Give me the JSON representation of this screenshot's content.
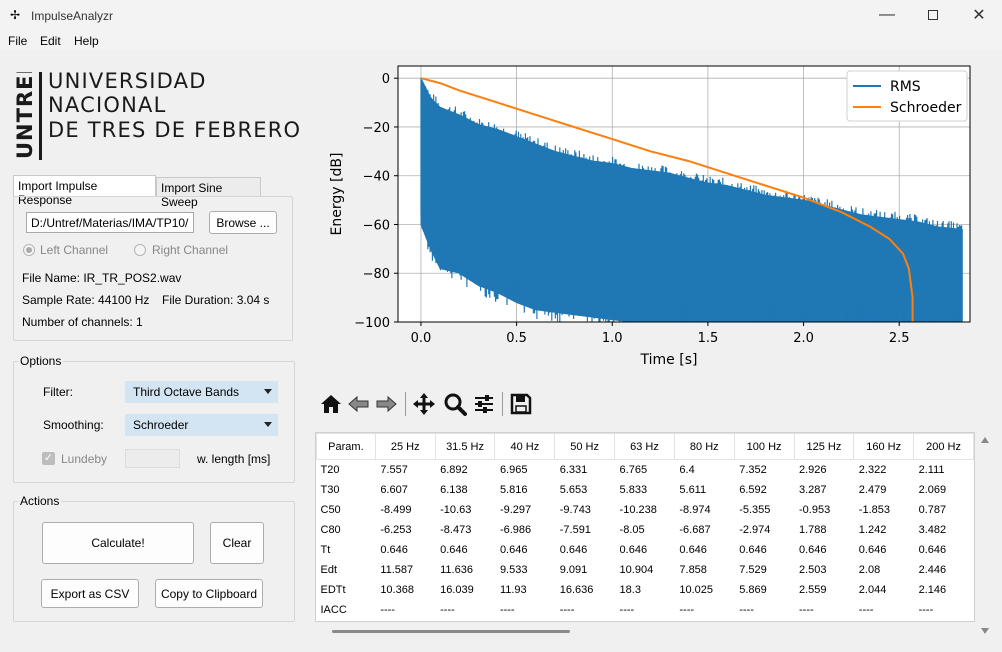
{
  "window": {
    "title": "ImpulseAnalyzr",
    "icon": "app-icon",
    "controls": [
      "minimize-icon",
      "maximize-icon",
      "close-icon"
    ]
  },
  "menu": {
    "items": [
      "File",
      "Edit",
      "Help"
    ]
  },
  "logo": {
    "vertical_text": "UNTREF",
    "lines": [
      "UNIVERSIDAD",
      "NACIONAL",
      "DE TRES DE FEBRERO"
    ]
  },
  "tabs": [
    {
      "label": "Import Impulse Response",
      "active": true
    },
    {
      "label": "Import Sine Sweep",
      "active": false
    }
  ],
  "import": {
    "path": "D:/Untref/Materias/IMA/TP10/",
    "browse_label": "Browse ...",
    "left_channel": "Left Channel",
    "right_channel": "Right Channel",
    "file_name": "File Name: IR_TR_POS2.wav",
    "sample_rate": "Sample Rate: 44100 Hz",
    "file_duration": "File Duration: 3.04 s",
    "channels": "Number of channels: 1"
  },
  "options": {
    "title": "Options",
    "filter_label": "Filter:",
    "filter_value": "Third Octave Bands",
    "smoothing_label": "Smoothing:",
    "smoothing_value": "Schroeder",
    "lundeby_label": "Lundeby",
    "lundeby_checked": true,
    "wlength_label": "w. length [ms]",
    "wlength_value": ""
  },
  "actions": {
    "title": "Actions",
    "calculate": "Calculate!",
    "clear": "Clear",
    "export_csv": "Export as CSV",
    "copy_clipboard": "Copy to Clipboard"
  },
  "toolbar": {
    "icons": [
      "home-icon",
      "back-icon",
      "forward-icon",
      "pan-icon",
      "zoom-icon",
      "configure-icon",
      "save-icon"
    ]
  },
  "colors": {
    "rms": "#1f77b4",
    "schroeder": "#ff7f0e",
    "combo_bg": "#d3e4f3"
  },
  "chart_data": {
    "type": "line",
    "title": "",
    "xlabel": "Time [s]",
    "ylabel": "Energy [dB]",
    "xlim": [
      -0.12,
      2.87
    ],
    "ylim": [
      -100,
      5
    ],
    "xticks": [
      "0.0",
      "0.5",
      "1.0",
      "1.5",
      "2.0",
      "2.5"
    ],
    "yticks": [
      "0",
      "−20",
      "−40",
      "−60",
      "−80",
      "−100"
    ],
    "legend": "top-right",
    "grid": true,
    "series": [
      {
        "name": "RMS",
        "x": [
          0.0,
          0.05,
          0.1,
          0.2,
          0.3,
          0.4,
          0.5,
          0.6,
          0.7,
          0.8,
          0.9,
          1.0,
          1.1,
          1.2,
          1.3,
          1.4,
          1.5,
          1.6,
          1.7,
          1.8,
          1.9,
          2.0,
          2.1,
          2.2,
          2.3,
          2.4,
          2.5,
          2.6,
          2.7,
          2.83
        ],
        "upper": [
          0,
          -8,
          -12,
          -15,
          -19,
          -21,
          -24,
          -27,
          -30,
          -32,
          -34,
          -35,
          -37,
          -38,
          -39,
          -41,
          -43,
          -44,
          -46,
          -48,
          -49,
          -50,
          -52,
          -54,
          -56,
          -57,
          -58,
          -59,
          -61,
          -62
        ],
        "lower": [
          -60,
          -70,
          -78,
          -80,
          -85,
          -88,
          -92,
          -95,
          -96,
          -97,
          -98,
          -99,
          -100,
          -100,
          -100,
          -100,
          -100,
          -100,
          -100,
          -100,
          -100,
          -100,
          -100,
          -100,
          -100,
          -100,
          -100,
          -100,
          -100,
          -100
        ]
      },
      {
        "name": "Schroeder",
        "x": [
          0.0,
          0.1,
          0.2,
          0.4,
          0.6,
          0.8,
          1.0,
          1.2,
          1.4,
          1.6,
          1.8,
          2.0,
          2.2,
          2.35,
          2.45,
          2.52,
          2.55,
          2.57,
          2.57
        ],
        "y": [
          0,
          -2,
          -5,
          -10,
          -15,
          -20,
          -25,
          -30,
          -34,
          -39,
          -44,
          -49,
          -55,
          -61,
          -66,
          -72,
          -78,
          -90,
          -100
        ]
      }
    ]
  },
  "results_table": {
    "columns": [
      "Param.",
      "25 Hz",
      "31.5 Hz",
      "40 Hz",
      "50 Hz",
      "63 Hz",
      "80 Hz",
      "100 Hz",
      "125 Hz",
      "160 Hz",
      "200 Hz"
    ],
    "rows": [
      [
        "T20",
        "7.557",
        "6.892",
        "6.965",
        "6.331",
        "6.765",
        "6.4",
        "7.352",
        "2.926",
        "2.322",
        "2.111"
      ],
      [
        "T30",
        "6.607",
        "6.138",
        "5.816",
        "5.653",
        "5.833",
        "5.611",
        "6.592",
        "3.287",
        "2.479",
        "2.069"
      ],
      [
        "C50",
        "-8.499",
        "-10.63",
        "-9.297",
        "-9.743",
        "-10.238",
        "-8.974",
        "-5.355",
        "-0.953",
        "-1.853",
        "0.787"
      ],
      [
        "C80",
        "-6.253",
        "-8.473",
        "-6.986",
        "-7.591",
        "-8.05",
        "-6.687",
        "-2.974",
        "1.788",
        "1.242",
        "3.482"
      ],
      [
        "Tt",
        "0.646",
        "0.646",
        "0.646",
        "0.646",
        "0.646",
        "0.646",
        "0.646",
        "0.646",
        "0.646",
        "0.646"
      ],
      [
        "Edt",
        "11.587",
        "11.636",
        "9.533",
        "9.091",
        "10.904",
        "7.858",
        "7.529",
        "2.503",
        "2.08",
        "2.446"
      ],
      [
        "EDTt",
        "10.368",
        "16.039",
        "11.93",
        "16.636",
        "18.3",
        "10.025",
        "5.869",
        "2.559",
        "2.044",
        "2.146"
      ],
      [
        "IACC",
        "----",
        "----",
        "----",
        "----",
        "----",
        "----",
        "----",
        "----",
        "----",
        "----"
      ]
    ]
  }
}
